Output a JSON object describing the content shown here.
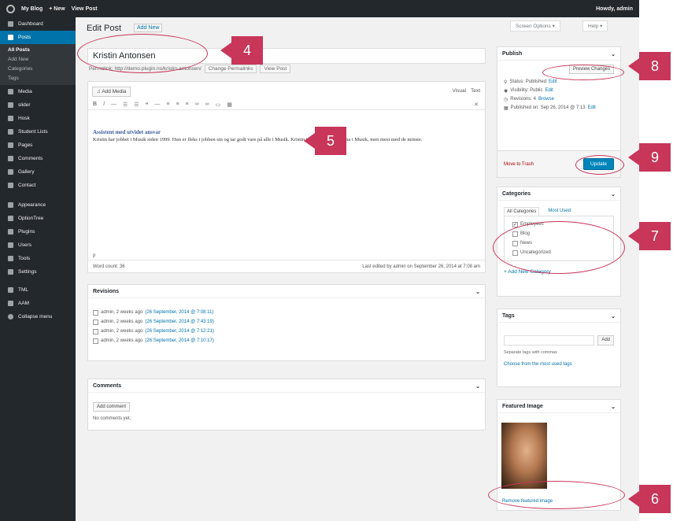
{
  "adminbar": {
    "site": "My Blog",
    "new": "+ New",
    "view": "View Post",
    "howdy": "Howdy, admin"
  },
  "menu": {
    "items": [
      {
        "label": "Dashboard"
      },
      {
        "label": "Posts",
        "active": true
      },
      {
        "label": "Media"
      },
      {
        "label": "slider"
      },
      {
        "label": "Hosk"
      },
      {
        "label": "Student Lists"
      },
      {
        "label": "Pages"
      },
      {
        "label": "Comments"
      },
      {
        "label": "Gallery"
      },
      {
        "label": "Contact"
      },
      {
        "label": "Appearance"
      },
      {
        "label": "OptionTree"
      },
      {
        "label": "Plugins"
      },
      {
        "label": "Users"
      },
      {
        "label": "Tools"
      },
      {
        "label": "Settings"
      },
      {
        "label": "TML"
      },
      {
        "label": "AAM"
      },
      {
        "label": "Collapse menu"
      }
    ],
    "posts_sub": [
      "All Posts",
      "Add New",
      "Categories",
      "Tags"
    ]
  },
  "header": {
    "title": "Edit Post",
    "add_new": "Add New",
    "screen_options": "Screen Options ▾",
    "help": "Help ▾"
  },
  "post": {
    "title": "Kristin Antonsen",
    "permalink_label": "Permalink: http://demo.plugin.no/kristin-antonsen/",
    "change_permalinks": "Change Permalinks",
    "view_post": "View Post",
    "add_media": "Add Media",
    "tab_visual": "Visual",
    "tab_text": "Text",
    "heading": "Assistent med utvidet ansvar",
    "body": "Kristin har jobbet i Musik siden 1999. Hun er fleks i jobben sin og tar godt vare på alle i Musik. Kristin jobber med alle barna i Musik, men mest med de minste.",
    "path": "p",
    "word_count": "Word count: 36",
    "last_edited": "Last edited by admin on September 26, 2014 at 7:08 am"
  },
  "revisions": {
    "title": "Revisions",
    "items": [
      {
        "who": "admin, 2 weeks ago",
        "date": "(26 September, 2014 @ 7:08:11)"
      },
      {
        "who": "admin, 2 weeks ago",
        "date": "(26 September, 2014 @ 7:43:19)"
      },
      {
        "who": "admin, 2 weeks ago",
        "date": "(26 September, 2014 @ 7:12:21)"
      },
      {
        "who": "admin, 2 weeks ago",
        "date": "(26 September, 2014 @ 7:10:17)"
      }
    ]
  },
  "comments": {
    "title": "Comments",
    "add": "Add comment",
    "none": "No comments yet."
  },
  "publish": {
    "title": "Publish",
    "preview": "Preview Changes",
    "status": "Status: Published",
    "visibility": "Visibility: Public",
    "revisions": "Revisions: 4",
    "browse": "Browse",
    "published_on": "Published on: Sep 26, 2014 @ 7:13",
    "edit": "Edit",
    "trash": "Move to Trash",
    "update": "Update"
  },
  "categories": {
    "title": "Categories",
    "tab_all": "All Categories",
    "tab_most": "Most Used",
    "items": [
      {
        "label": "Employees",
        "checked": true
      },
      {
        "label": "Blog",
        "checked": false
      },
      {
        "label": "News",
        "checked": false
      },
      {
        "label": "Uncategorized",
        "checked": false
      }
    ],
    "add_new": "+ Add New Category"
  },
  "tags": {
    "title": "Tags",
    "add": "Add",
    "hint": "Separate tags with commas",
    "choose": "Choose from the most used tags"
  },
  "featured": {
    "title": "Featured Image",
    "remove": "Remove featured image"
  },
  "callouts": [
    "4",
    "5",
    "6",
    "7",
    "8",
    "9"
  ],
  "colors": {
    "admin_dark": "#23282d",
    "accent": "#0073aa",
    "callout": "#c8365a"
  }
}
